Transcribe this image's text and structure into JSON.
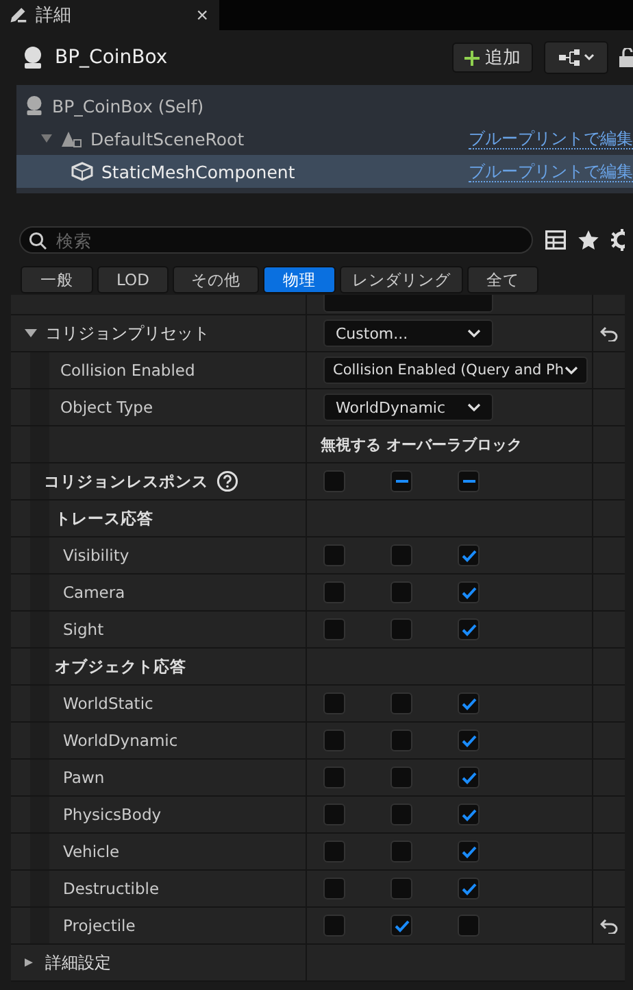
{
  "tab": {
    "title": "詳細",
    "close": "×"
  },
  "header": {
    "title": "BP_CoinBox",
    "add_button": "追加"
  },
  "tree": [
    {
      "label": "BP_CoinBox (Self)",
      "selected": false,
      "children": [
        {
          "label": "DefaultSceneRoot",
          "selected": false,
          "link": "ブループリントで編集",
          "expanded": true,
          "children": [
            {
              "label": "StaticMeshComponent",
              "selected": true,
              "link": "ブループリントで編集"
            }
          ]
        }
      ]
    }
  ],
  "search": {
    "placeholder": "検索"
  },
  "filters": [
    {
      "label": "一般",
      "selected": false
    },
    {
      "label": "LOD",
      "selected": false
    },
    {
      "label": "その他",
      "selected": false
    },
    {
      "label": "物理",
      "selected": true
    },
    {
      "label": "レンダリング",
      "selected": false
    },
    {
      "label": "全て",
      "selected": false
    }
  ],
  "categories": [
    {
      "label": "コリジョンプリセット",
      "expanded": true,
      "value": "Custom...",
      "reset": true,
      "children": [
        {
          "kind": "dropdown",
          "label": "Collision Enabled",
          "value": "Collision Enabled (Query and Ph",
          "wide": true
        },
        {
          "kind": "dropdown",
          "label": "Object Type",
          "value": "WorldDynamic",
          "wide": false
        },
        {
          "kind": "columns",
          "headers": [
            "無視する",
            "オーバーラ",
            "ブロック"
          ]
        },
        {
          "kind": "response",
          "label": "コリジョンレスポンス",
          "boxes": [
            {
              "mixed": false
            },
            {
              "mixed": true
            },
            {
              "mixed": true
            }
          ]
        },
        {
          "kind": "section",
          "label": "トレース応答",
          "children": [
            {
              "kind": "channel",
              "label": "Visibility",
              "boxes": [
                {
                  "checked": false
                },
                {
                  "checked": false
                },
                {
                  "checked": true
                }
              ],
              "reset": false
            },
            {
              "kind": "channel",
              "label": "Camera",
              "boxes": [
                {
                  "checked": false
                },
                {
                  "checked": false
                },
                {
                  "checked": true
                }
              ],
              "reset": false
            },
            {
              "kind": "channel",
              "label": "Sight",
              "boxes": [
                {
                  "checked": false
                },
                {
                  "checked": false
                },
                {
                  "checked": true
                }
              ],
              "reset": false
            }
          ]
        },
        {
          "kind": "section",
          "label": "オブジェクト応答",
          "children": [
            {
              "kind": "channel",
              "label": "WorldStatic",
              "boxes": [
                {
                  "checked": false
                },
                {
                  "checked": false
                },
                {
                  "checked": true
                }
              ],
              "reset": false
            },
            {
              "kind": "channel",
              "label": "WorldDynamic",
              "boxes": [
                {
                  "checked": false
                },
                {
                  "checked": false
                },
                {
                  "checked": true
                }
              ],
              "reset": false
            },
            {
              "kind": "channel",
              "label": "Pawn",
              "boxes": [
                {
                  "checked": false
                },
                {
                  "checked": false
                },
                {
                  "checked": true
                }
              ],
              "reset": false
            },
            {
              "kind": "channel",
              "label": "PhysicsBody",
              "boxes": [
                {
                  "checked": false
                },
                {
                  "checked": false
                },
                {
                  "checked": true
                }
              ],
              "reset": false
            },
            {
              "kind": "channel",
              "label": "Vehicle",
              "boxes": [
                {
                  "checked": false
                },
                {
                  "checked": false
                },
                {
                  "checked": true
                }
              ],
              "reset": false
            },
            {
              "kind": "channel",
              "label": "Destructible",
              "boxes": [
                {
                  "checked": false
                },
                {
                  "checked": false
                },
                {
                  "checked": true
                }
              ],
              "reset": false
            },
            {
              "kind": "channel",
              "label": "Projectile",
              "boxes": [
                {
                  "checked": false
                },
                {
                  "checked": true
                },
                {
                  "checked": false
                }
              ],
              "reset": true
            }
          ]
        }
      ]
    },
    {
      "label": "詳細設定",
      "expanded": false
    }
  ]
}
